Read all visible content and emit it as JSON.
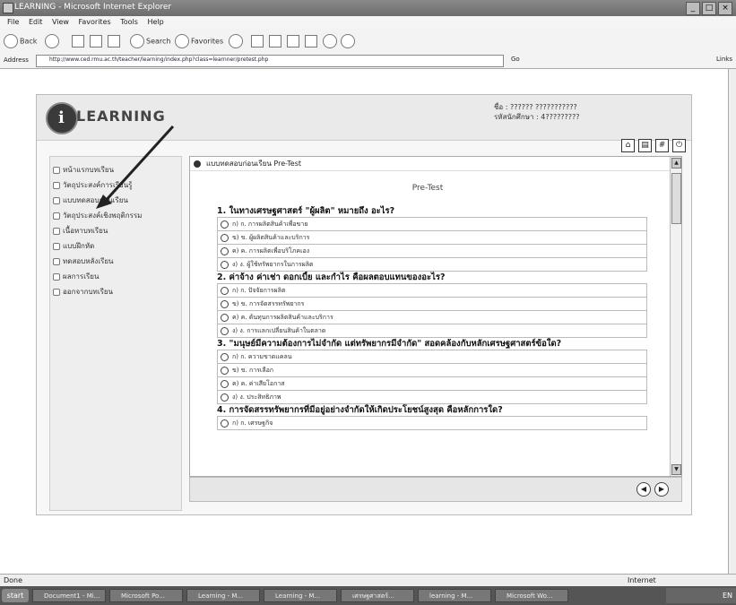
{
  "window": {
    "title": "LEARNING - Microsoft Internet Explorer",
    "controls": [
      "_",
      "□",
      "×"
    ]
  },
  "menubar": [
    "File",
    "Edit",
    "View",
    "Favorites",
    "Tools",
    "Help"
  ],
  "toolbar": {
    "back": "Back",
    "search": "Search",
    "favorites": "Favorites"
  },
  "address": {
    "label": "Address",
    "url": "http://www.ced.rmu.ac.th/teacher/learning/index.php?class=learnner/pretest.php",
    "go": "Go",
    "links": "Links"
  },
  "app": {
    "logo": "LEARNING",
    "user_line1": "ชื่อ : ?????? ???????????",
    "user_line2": "รหัสนักศึกษา : 4?????????"
  },
  "sidebar": {
    "items": [
      "หน้าแรกบทเรียน",
      "วัตถุประสงค์การเรียนรู้",
      "แบบทดสอบก่อนเรียน",
      "วัตถุประสงค์เชิงพฤติกรรม",
      "เนื้อหาบทเรียน",
      "แบบฝึกหัด",
      "ทดสอบหลังเรียน",
      "ผลการเรียน",
      "ออกจากบทเรียน"
    ]
  },
  "content": {
    "header": "แบบทดสอบก่อนเรียน Pre-Test",
    "title": "Pre-Test",
    "questions": [
      {
        "q": "1. ในทางเศรษฐศาสตร์ \"ผู้ผลิต\" หมายถึง อะไร?",
        "options": [
          "ก) ก. การผลิตสินค้าเพื่อขาย",
          "ข) ข. ผู้ผลิตสินค้าและบริการ",
          "ค) ค. การผลิตเพื่อบริโภคเอง",
          "ง) ง. ผู้ใช้ทรัพยากรในการผลิต"
        ]
      },
      {
        "q": "2. ค่าจ้าง ค่าเช่า ดอกเบี้ย และกำไร คือผลตอบแทนของอะไร?",
        "options": [
          "ก) ก. ปัจจัยการผลิต",
          "ข) ข. การจัดสรรทรัพยากร",
          "ค) ค. ต้นทุนการผลิตสินค้าและบริการ",
          "ง) ง. การแลกเปลี่ยนสินค้าในตลาด"
        ]
      },
      {
        "q": "3. \"มนุษย์มีความต้องการไม่จำกัด แต่ทรัพยากรมีจำกัด\" สอดคล้องกับหลักเศรษฐศาสตร์ข้อใด?",
        "options": [
          "ก) ก. ความขาดแคลน",
          "ข) ข. การเลือก",
          "ค) ค. ค่าเสียโอกาส",
          "ง) ง. ประสิทธิภาพ"
        ]
      },
      {
        "q": "4. การจัดสรรทรัพยากรที่มีอยู่อย่างจำกัดให้เกิดประโยชน์สูงสุด คือหลักการใด?",
        "options": [
          "ก) ก. เศรษฐกิจ"
        ]
      }
    ]
  },
  "statusbar": {
    "left": "Done",
    "right": "Internet"
  },
  "taskbar": {
    "start": "start",
    "tasks": [
      "Document1 - Mi...",
      "Microsoft Po...",
      "Learning - M...",
      "Learning - M...",
      "เศรษฐศาสตร์...",
      "learning - M...",
      "Microsoft Wo..."
    ],
    "tray": "EN"
  }
}
